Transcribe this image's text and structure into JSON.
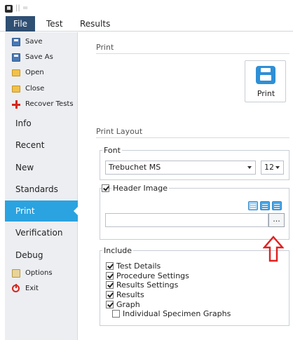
{
  "menubar": {
    "file": "File",
    "test": "Test",
    "results": "Results"
  },
  "sidebar": {
    "commands": [
      {
        "label": "Save",
        "icon": "save-icon"
      },
      {
        "label": "Save As",
        "icon": "save-as-icon"
      },
      {
        "label": "Open",
        "icon": "folder-open-icon"
      },
      {
        "label": "Close",
        "icon": "folder-close-icon"
      },
      {
        "label": "Recover Tests",
        "icon": "recover-plus-icon"
      }
    ],
    "nav": [
      "Info",
      "Recent",
      "New",
      "Standards",
      "Print",
      "Verification",
      "Debug"
    ],
    "active_nav": "Print",
    "footer": [
      {
        "label": "Options",
        "icon": "options-icon"
      },
      {
        "label": "Exit",
        "icon": "power-icon"
      }
    ]
  },
  "print_section": {
    "title": "Print",
    "button_label": "Print"
  },
  "layout_section": {
    "title": "Print Layout"
  },
  "font_group": {
    "legend": "Font",
    "font_family": "Trebuchet MS",
    "font_size": "12"
  },
  "header_group": {
    "checkbox_label": "Header Image",
    "checked": true,
    "path_value": "",
    "browse_label": "..."
  },
  "include_group": {
    "legend": "Include",
    "items": [
      {
        "label": "Test Details",
        "checked": true
      },
      {
        "label": "Procedure Settings",
        "checked": true
      },
      {
        "label": "Results Settings",
        "checked": true
      },
      {
        "label": "Results",
        "checked": true
      },
      {
        "label": "Graph",
        "checked": true
      },
      {
        "label": "Individual Specimen Graphs",
        "checked": false
      }
    ]
  },
  "colors": {
    "accent": "#2aa3e0",
    "file_tab": "#2f4f73",
    "annotation_arrow": "#e02020"
  }
}
